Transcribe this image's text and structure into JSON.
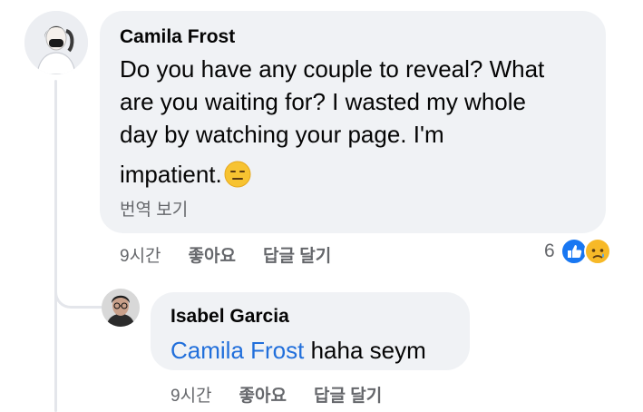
{
  "comment": {
    "author": "Camila Frost",
    "text_lines": [
      "Do you have any couple to reveal? What",
      "are you waiting for? I wasted my whole",
      "day by watching your page. I'm",
      "impatient."
    ],
    "emoji_icon": "expressionless-face-icon",
    "translate_label": "번역 보기",
    "time": "9시간",
    "like_label": "좋아요",
    "reply_label": "답글 달기",
    "reaction_count": "6",
    "reaction_icons": [
      "like-icon",
      "sad-icon"
    ]
  },
  "reply": {
    "author": "Isabel Garcia",
    "mention": "Camila Frost",
    "text": " haha seym",
    "time": "9시간",
    "like_label": "좋아요",
    "reply_label": "답글 달기"
  },
  "colors": {
    "bubble": "#f0f2f5",
    "secondary_text": "#65676b",
    "mention": "#216fdb",
    "like_blue": "#1877f2",
    "sad_yellow": "#f7b928"
  }
}
